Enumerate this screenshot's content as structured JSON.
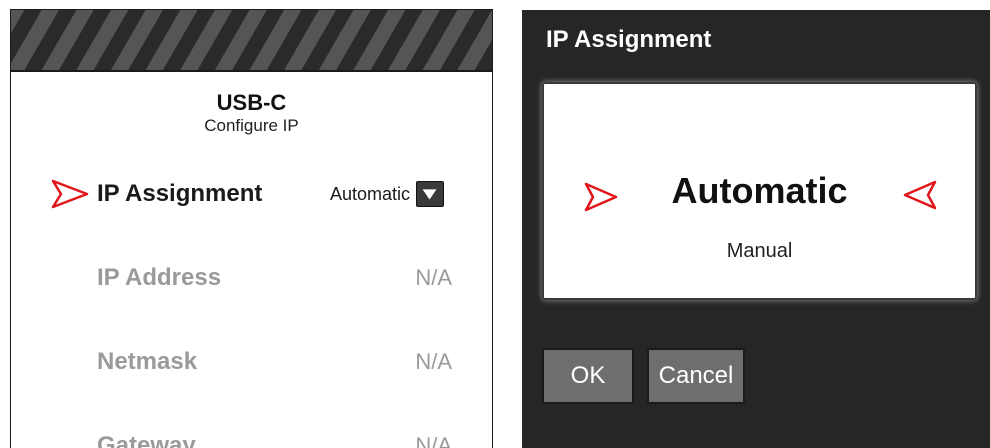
{
  "left_panel": {
    "title": "USB-C",
    "subtitle": "Configure IP",
    "rows": [
      {
        "label": "IP Assignment",
        "value": "Automatic"
      },
      {
        "label": "IP Address",
        "value": "N/A"
      },
      {
        "label": "Netmask",
        "value": "N/A"
      },
      {
        "label": "Gateway",
        "value": "N/A"
      }
    ]
  },
  "dialog": {
    "title": "IP Assignment",
    "options": [
      "Automatic",
      "Manual"
    ],
    "ok_label": "OK",
    "cancel_label": "Cancel"
  },
  "colors": {
    "selector_red": "#e0161b",
    "dialog_bg": "#262626",
    "button_bg": "#6e6e6e",
    "dim_text": "#9a9a9a"
  },
  "icons": {
    "row_selector": "chevron-right-icon",
    "dropdown": "chevron-down-icon",
    "dialog_left_selector": "chevron-right-icon",
    "dialog_right_selector": "chevron-left-icon"
  }
}
